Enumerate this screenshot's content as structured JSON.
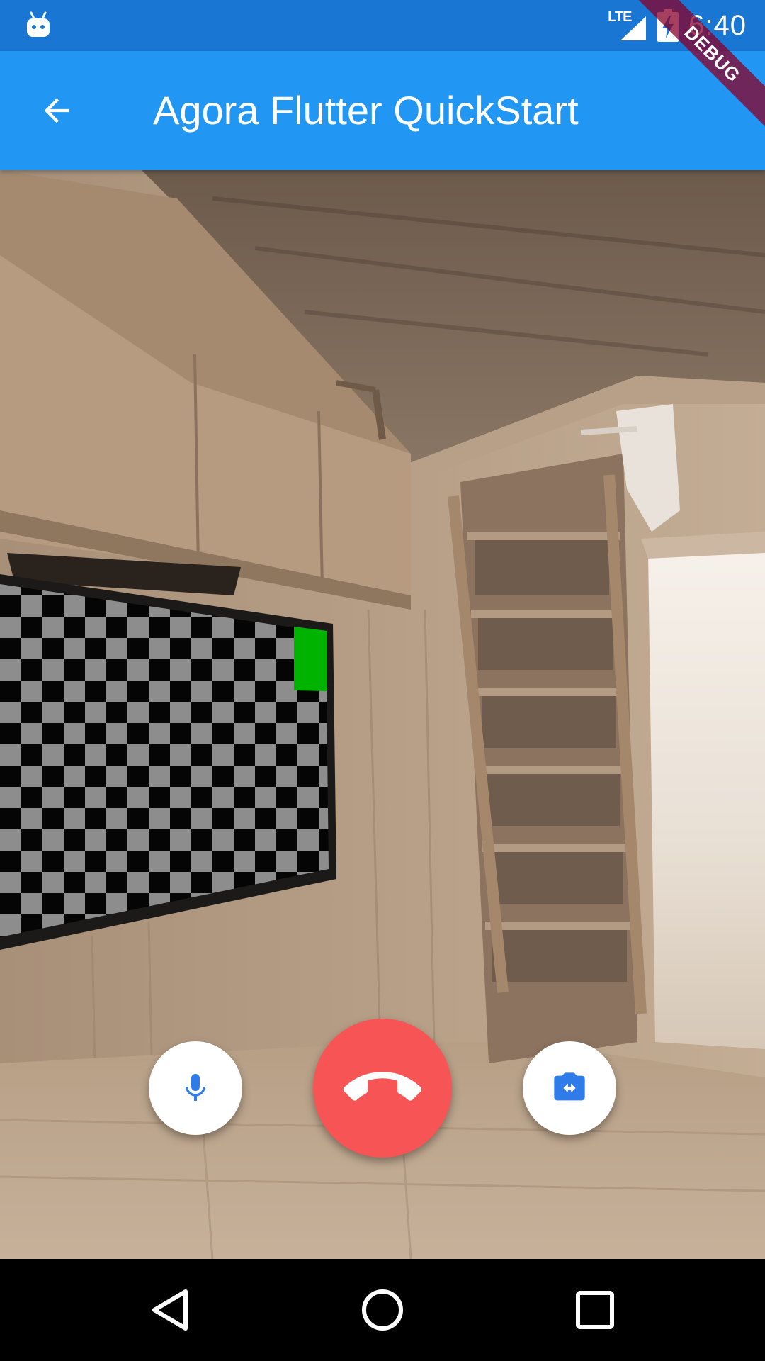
{
  "status_bar": {
    "network_label": "LTE",
    "time": "6:40",
    "notification_icon": "android-robot-icon",
    "signal_icon": "cell-signal-icon",
    "battery_icon": "battery-charging-icon"
  },
  "debug_banner": {
    "label": "DEBUG"
  },
  "app_bar": {
    "title": "Agora Flutter QuickStart",
    "back_icon": "arrow-back-icon"
  },
  "video": {
    "description_icon": "remote-video-feed"
  },
  "controls": {
    "mute_icon": "mic-icon",
    "end_call_icon": "call-end-icon",
    "switch_camera_icon": "switch-camera-icon"
  },
  "nav_bar": {
    "back_icon": "nav-back-triangle-icon",
    "home_icon": "nav-home-circle-icon",
    "recents_icon": "nav-recents-square-icon"
  },
  "colors": {
    "status_bar": "#1976D2",
    "app_bar": "#2196F3",
    "end_call": "#F75555",
    "control_icon": "#2F7BEA",
    "debug_banner": "#880028"
  }
}
